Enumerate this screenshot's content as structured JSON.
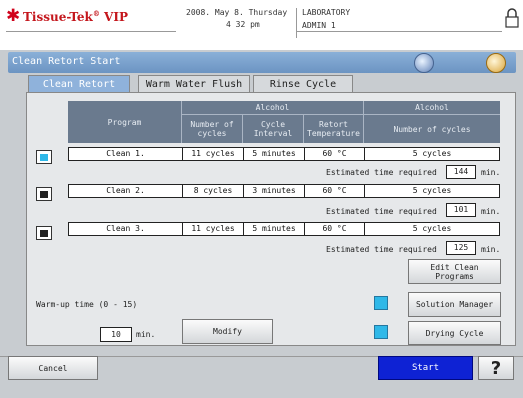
{
  "header": {
    "brand": "Tissue-Tek",
    "brand_suffix": "VIP",
    "brand_reg": "®",
    "date": "2008. May 8. Thursday",
    "time": "4 32 pm",
    "location": "LABORATORY",
    "user": "ADMIN 1"
  },
  "titlebar": {
    "title": "Clean Retort Start"
  },
  "tabs": [
    {
      "label": "Clean Retort",
      "active": true
    },
    {
      "label": "Warm Water Flush",
      "active": false
    },
    {
      "label": "Rinse Cycle",
      "active": false
    }
  ],
  "table": {
    "group_alcohol": "Alcohol",
    "group_alcohol2": "Alcohol",
    "col_program": "Program",
    "col_num_cycles": "Number of cycles",
    "col_cycle_interval": "Cycle Interval",
    "col_retort_temp": "Retort Temperature",
    "col_num_cycles2": "Number of cycles",
    "rows": [
      {
        "program": "Clean 1.",
        "cycles": "11 cycles",
        "interval": "5 minutes",
        "temp": "60 °C",
        "cycles2": "5 cycles",
        "est_label": "Estimated time required",
        "est_value": "144",
        "est_unit": "min.",
        "selected": true
      },
      {
        "program": "Clean 2.",
        "cycles": "8 cycles",
        "interval": "3 minutes",
        "temp": "60 °C",
        "cycles2": "5 cycles",
        "est_label": "Estimated time required",
        "est_value": "101",
        "est_unit": "min.",
        "selected": false
      },
      {
        "program": "Clean 3.",
        "cycles": "11 cycles",
        "interval": "5 minutes",
        "temp": "60 °C",
        "cycles2": "5 cycles",
        "est_label": "Estimated time required",
        "est_value": "125",
        "est_unit": "min.",
        "selected": false
      }
    ]
  },
  "buttons": {
    "edit_clean": "Edit Clean Programs",
    "solution_manager": "Solution Manager",
    "drying_cycle": "Drying Cycle",
    "modify": "Modify",
    "cancel": "Cancel",
    "start": "Start",
    "help": "?"
  },
  "warmup": {
    "label": "Warm-up time (0 - 15)",
    "value": "10",
    "unit": "min."
  },
  "colors": {
    "accent": "#2fb8e8",
    "start": "#0e22d4",
    "brand": "#c4161c",
    "titlebar": "#7aa2cf"
  }
}
